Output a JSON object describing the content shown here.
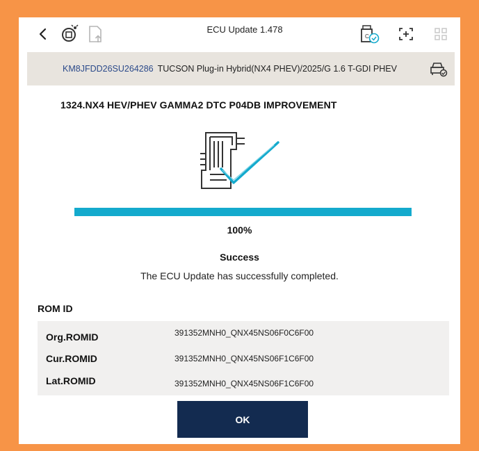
{
  "header": {
    "title": "ECU Update 1.478",
    "back_icon": "chevron-left-icon",
    "left_icons": [
      "ecu-diagnostic-icon",
      "document-upload-icon"
    ],
    "right_icons": [
      "usb-check-icon",
      "fullscreen-icon",
      "grid-icon"
    ]
  },
  "vehicle": {
    "vin": "KM8JFDD26SU264286",
    "model": "TUCSON Plug-in Hybrid(NX4 PHEV)/2025/G 1.6 T-GDI PHEV",
    "icon": "vehicle-settings-icon"
  },
  "update": {
    "title": "1324.NX4 HEV/PHEV GAMMA2 DTC P04DB IMPROVEMENT",
    "progress_percent": 100,
    "progress_label": "100%",
    "status": "Success",
    "message": "The ECU Update has successfully completed."
  },
  "rom": {
    "label": "ROM ID",
    "rows": [
      {
        "label": "Org.ROMID",
        "value": "391352MNH0_QNX45NS06F0C6F00"
      },
      {
        "label": "Cur.ROMID",
        "value": "391352MNH0_QNX45NS06F1C6F00"
      },
      {
        "label": "Lat.ROMID",
        "value": "391352MNH0_QNX45NS06F1C6F00"
      }
    ]
  },
  "actions": {
    "ok_label": "OK"
  },
  "colors": {
    "accent": "#14aacd",
    "button": "#132b50",
    "frame": "#f79447",
    "vin": "#2b4a8a"
  }
}
